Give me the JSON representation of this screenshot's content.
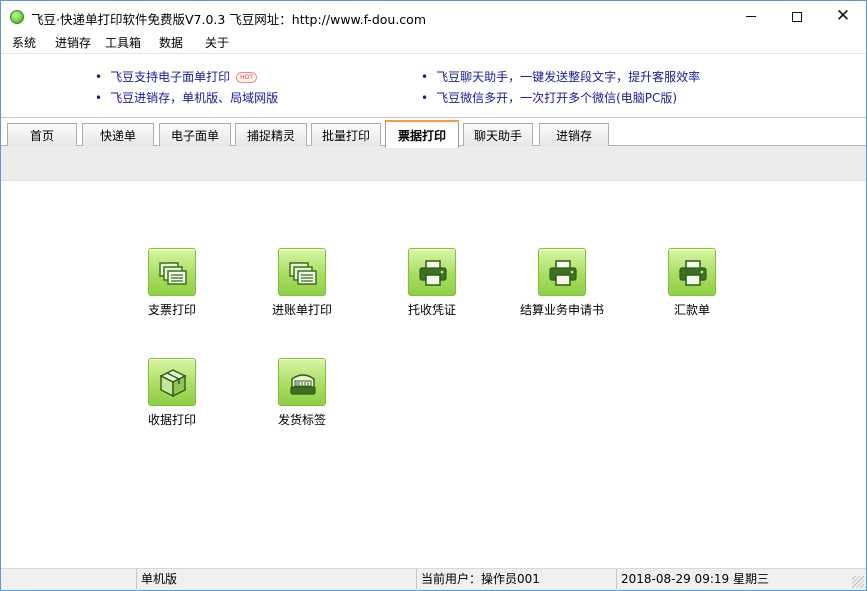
{
  "window": {
    "title": "飞豆·快递单打印软件免费版V7.0.3  飞豆网址：http://www.f-dou.com"
  },
  "menu": [
    "系统",
    "进销存",
    "工具箱",
    "数据",
    "关于"
  ],
  "ads": {
    "left": [
      "飞豆支持电子面单打印",
      "飞豆进销存，单机版、局域网版"
    ],
    "hot_badge": "HOT",
    "right": [
      "飞豆聊天助手，一键发送整段文字，提升客服效率",
      "飞豆微信多开，一次打开多个微信(电脑PC版)"
    ],
    "link_color": "#1a1a9c"
  },
  "tabs": [
    "首页",
    "快递单",
    "电子面单",
    "捕捉精灵",
    "批量打印",
    "票据打印",
    "聊天助手",
    "进销存"
  ],
  "active_tab": "票据打印",
  "tiles": [
    {
      "label": "支票打印",
      "icon": "documents-icon"
    },
    {
      "label": "进账单打印",
      "icon": "documents-icon"
    },
    {
      "label": "托收凭证",
      "icon": "printer-icon"
    },
    {
      "label": "结算业务申请书",
      "icon": "printer-icon"
    },
    {
      "label": "汇款单",
      "icon": "printer-icon"
    },
    {
      "label": "收据打印",
      "icon": "box-icon"
    },
    {
      "label": "发货标签",
      "icon": "label-printer-icon"
    }
  ],
  "status": {
    "edition": "单机版",
    "user": "当前用户：操作员001",
    "datetime": "2018-08-29 09:19 星期三"
  },
  "colors": {
    "accent_tab": "#f0a23c",
    "tile_green": "#a9de62"
  }
}
